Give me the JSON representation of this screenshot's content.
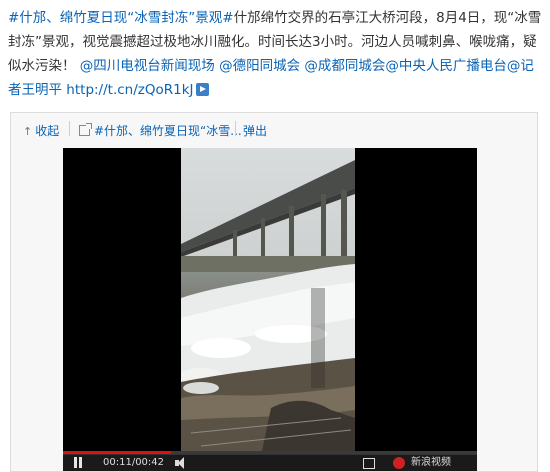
{
  "post": {
    "topic_tag": "#什邡、绵竹夏日现“冰雪封冻”景观#",
    "body": "什邡绵竹交界的石亭江大桥河段，8月4日，现“冰雪封冻”景观，视觉震撼超过极地冰川融化。时间长达3小时。河边人员喊刺鼻、喉咙痛，疑似水污染！",
    "mentions": [
      "@四川电视台新闻现场",
      "@德阳同城会",
      "@成都同城会",
      "@中央人民广播电台",
      "@记者王明平"
    ],
    "short_link": "http://t.cn/zQoR1kJ"
  },
  "media_toolbar": {
    "collapse_label": "收起",
    "video_title": "#什邡、绵竹夏日现“冰雪...",
    "popout_label": "弹出"
  },
  "player": {
    "time_text": "00:11/00:42",
    "brand_text": "新浪视频",
    "progress_fraction": 0.26
  },
  "icons": {
    "collapse": "arrow-up-icon",
    "video_link": "external-link-icon",
    "play_pause": "pause-icon",
    "volume": "volume-icon",
    "fullscreen": "fullscreen-icon",
    "brand": "sina-logo-icon",
    "short_link": "video-link-icon"
  },
  "colors": {
    "link": "#0a63b5",
    "text": "#333333",
    "player_bg": "#000000",
    "progress": "#dd1111"
  }
}
